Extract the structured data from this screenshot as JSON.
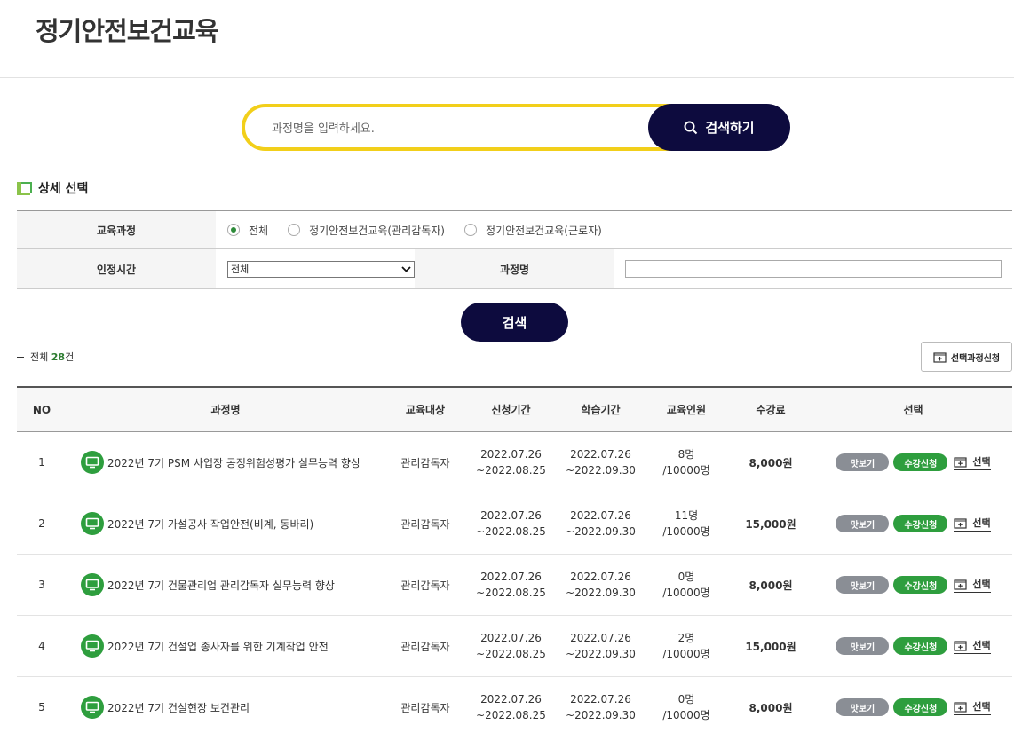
{
  "page": {
    "title": "정기안전보건교육"
  },
  "search": {
    "placeholder": "과정명을 입력하세요.",
    "button_label": "검색하기"
  },
  "detail": {
    "section_title": "상세 선택",
    "course_label": "교육과정",
    "course_options": [
      "전체",
      "정기안전보건교육(관리감독자)",
      "정기안전보건교육(근로자)"
    ],
    "course_selected": "전체",
    "hours_label": "인정시간",
    "hours_value": "전체",
    "name_label": "과정명",
    "name_value": "",
    "submit_label": "검색"
  },
  "summary": {
    "total_prefix": "전체",
    "total_count": "28",
    "total_suffix": "건",
    "apply_selected_label": "선택과정신청"
  },
  "table": {
    "headers": [
      "NO",
      "과정명",
      "교육대상",
      "신청기간",
      "학습기간",
      "교육인원",
      "수강료",
      "선택"
    ],
    "preview_label": "맛보기",
    "enroll_label": "수강신청",
    "select_label": "선택",
    "rows": [
      {
        "no": "1",
        "title": "2022년 7기 PSM 사업장 공정위험성평가 실무능력 향상",
        "target": "관리감독자",
        "apply_start": "2022.07.26",
        "apply_end": "~2022.08.25",
        "study_start": "2022.07.26",
        "study_end": "~2022.09.30",
        "enrolled": "8명",
        "capacity": "/10000명",
        "fee": "8,000원"
      },
      {
        "no": "2",
        "title": "2022년 7기 가설공사 작업안전(비계, 동바리)",
        "target": "관리감독자",
        "apply_start": "2022.07.26",
        "apply_end": "~2022.08.25",
        "study_start": "2022.07.26",
        "study_end": "~2022.09.30",
        "enrolled": "11명",
        "capacity": "/10000명",
        "fee": "15,000원"
      },
      {
        "no": "3",
        "title": "2022년 7기 건물관리업 관리감독자 실무능력 향상",
        "target": "관리감독자",
        "apply_start": "2022.07.26",
        "apply_end": "~2022.08.25",
        "study_start": "2022.07.26",
        "study_end": "~2022.09.30",
        "enrolled": "0명",
        "capacity": "/10000명",
        "fee": "8,000원"
      },
      {
        "no": "4",
        "title": "2022년 7기 건설업 종사자를 위한 기계작업 안전",
        "target": "관리감독자",
        "apply_start": "2022.07.26",
        "apply_end": "~2022.08.25",
        "study_start": "2022.07.26",
        "study_end": "~2022.09.30",
        "enrolled": "2명",
        "capacity": "/10000명",
        "fee": "15,000원"
      },
      {
        "no": "5",
        "title": "2022년 7기 건설현장 보건관리",
        "target": "관리감독자",
        "apply_start": "2022.07.26",
        "apply_end": "~2022.08.25",
        "study_start": "2022.07.26",
        "study_end": "~2022.09.30",
        "enrolled": "0명",
        "capacity": "/10000명",
        "fee": "8,000원"
      }
    ]
  },
  "colors": {
    "navy": "#0d0b3e",
    "yellow": "#f2cf1a",
    "green": "#2e9e3e",
    "gray": "#8a8e95"
  }
}
